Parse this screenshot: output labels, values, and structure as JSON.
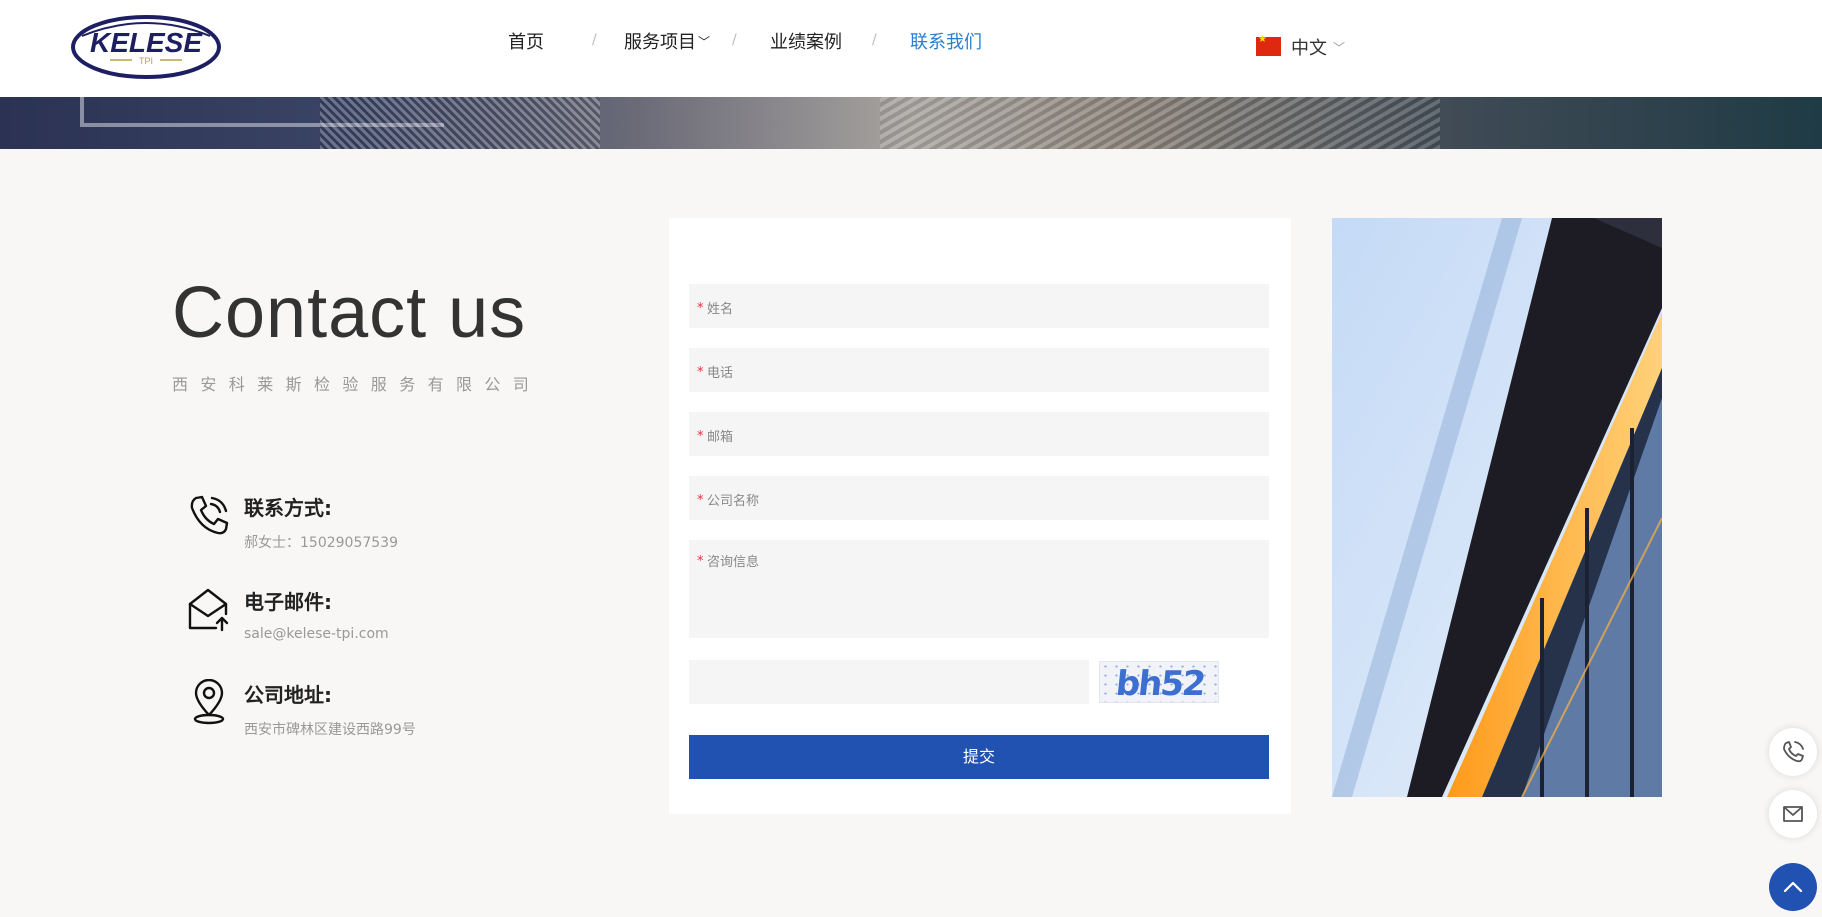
{
  "brand": {
    "logo_text": "KELESE",
    "logo_sub": "TPI"
  },
  "nav": {
    "items": [
      {
        "label": "首页"
      },
      {
        "label": "服务项目"
      },
      {
        "label": "业绩案例"
      },
      {
        "label": "联系我们"
      }
    ],
    "separator": "/",
    "active_color": "#2a7fd0"
  },
  "language": {
    "label": "中文",
    "flag": "china-flag-icon"
  },
  "contact": {
    "title": "Contact us",
    "company": "西安科莱斯检验服务有限公司",
    "items": [
      {
        "icon": "phone-icon",
        "label": "联系方式:",
        "value": "郝女士：15029057539"
      },
      {
        "icon": "mail-icon",
        "label": "电子邮件:",
        "value": "sale@kelese-tpi.com"
      },
      {
        "icon": "location-pin-icon",
        "label": "公司地址:",
        "value": "西安市碑林区建设西路99号"
      }
    ]
  },
  "form": {
    "required_mark": "*",
    "fields": [
      {
        "placeholder": "姓名"
      },
      {
        "placeholder": "电话"
      },
      {
        "placeholder": "邮箱"
      },
      {
        "placeholder": "公司名称"
      },
      {
        "placeholder": "咨询信息"
      }
    ],
    "captcha_text": "bh52",
    "submit_label": "提交",
    "submit_color": "#2252b1"
  },
  "side_tools": [
    {
      "icon": "phone-icon"
    },
    {
      "icon": "mail-icon"
    },
    {
      "icon": "arrow-up-icon"
    }
  ]
}
